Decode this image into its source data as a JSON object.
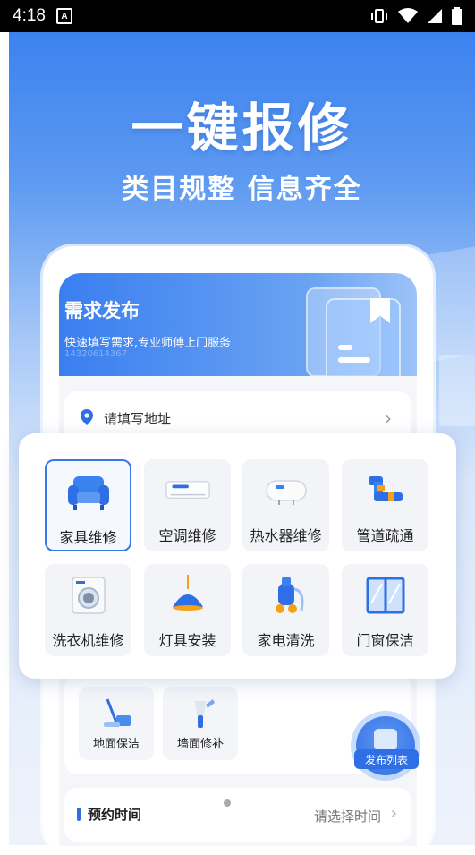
{
  "status_bar": {
    "time": "4:18",
    "badge": "A"
  },
  "hero": {
    "title": "一键报修",
    "subtitle": "类目规整 信息齐全"
  },
  "banner": {
    "title": "需求发布",
    "description": "快速填写需求,专业师傅上门服务",
    "faded_number": "14320614367"
  },
  "address": {
    "placeholder": "请填写地址"
  },
  "categories": [
    {
      "label": "家具维修",
      "icon": "sofa-icon",
      "selected": true
    },
    {
      "label": "空调维修",
      "icon": "air-conditioner-icon"
    },
    {
      "label": "热水器维修",
      "icon": "water-heater-icon"
    },
    {
      "label": "管道疏通",
      "icon": "pipe-icon"
    },
    {
      "label": "洗衣机维修",
      "icon": "washing-machine-icon"
    },
    {
      "label": "灯具安装",
      "icon": "lamp-icon"
    },
    {
      "label": "家电清洗",
      "icon": "vacuum-icon"
    },
    {
      "label": "门窗保洁",
      "icon": "window-icon"
    }
  ],
  "more_categories": [
    {
      "label": "地面保洁",
      "icon": "mop-icon"
    },
    {
      "label": "墙面修补",
      "icon": "wall-repair-icon"
    }
  ],
  "appointment": {
    "label": "预约时间",
    "placeholder": "请选择时间"
  },
  "fab": {
    "label": "发布列表"
  },
  "colors": {
    "primary": "#2f6fe6",
    "accent_orange": "#f4a21a"
  }
}
